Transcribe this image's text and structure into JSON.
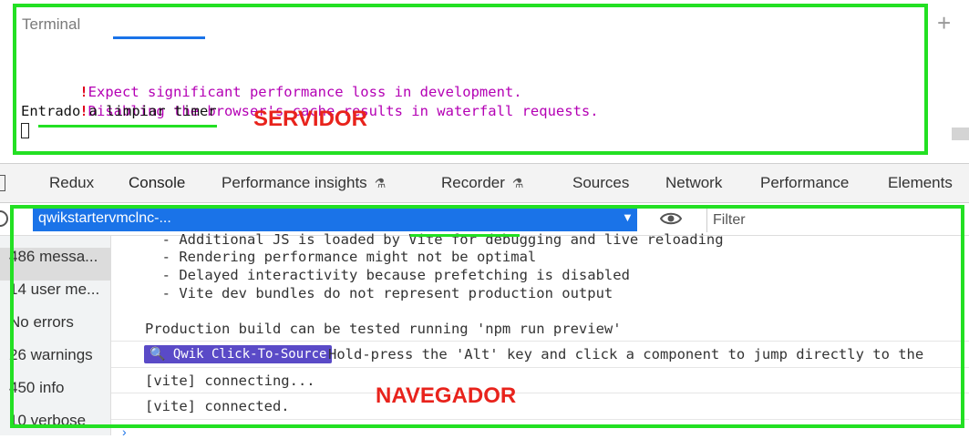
{
  "terminal": {
    "title": "Terminal",
    "plus": "+",
    "warnings": [
      "Expect significant performance loss in development.",
      "Disabling the browser's cache results in waterfall requests."
    ],
    "warning_mark": "!",
    "output_line": "Entrado a limpiar timer"
  },
  "devtools": {
    "tabs": [
      {
        "label": "Redux"
      },
      {
        "label": "Console",
        "active": true
      },
      {
        "label": "Performance insights",
        "flask": "⏶"
      },
      {
        "label": "Recorder",
        "flask": "⏶"
      },
      {
        "label": "Sources"
      },
      {
        "label": "Network"
      },
      {
        "label": "Performance"
      },
      {
        "label": "Elements"
      }
    ],
    "accent_color": "#1a73e8"
  },
  "console_toolbar": {
    "context": "qwikstartervmclnc-...",
    "filter_placeholder": "Filter"
  },
  "sidebar": {
    "items": [
      "486 messa...",
      "14 user me...",
      "No errors",
      "26 warnings",
      "450 info",
      "10 verbose"
    ]
  },
  "console_output": {
    "lines": [
      "  - Additional JS is loaded by Vite for debugging and live reloading",
      "  - Rendering performance might not be optimal",
      "  - Delayed interactivity because prefetching is disabled",
      "  - Vite dev bundles do not represent production output"
    ],
    "production_line": "Production build can be tested running 'npm run preview'",
    "qwik_badge": "🔍 Qwik Click-To-Source",
    "qwik_text": "Hold-press the 'Alt' key and click a component to jump directly to the",
    "vite_connecting": "[vite] connecting...",
    "vite_connected": "[vite] connected."
  },
  "annotations": {
    "servidor": "SERVIDOR",
    "navegador": "NAVEGADOR",
    "highlight_color": "#23e023",
    "label_color": "#e8231c"
  }
}
